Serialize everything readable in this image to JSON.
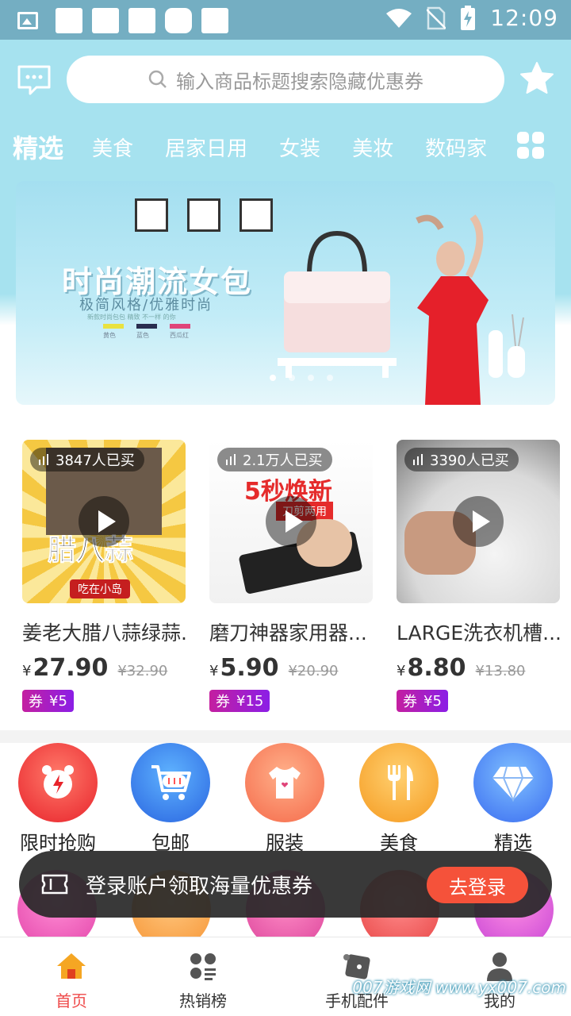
{
  "status_bar": {
    "time": "12:09"
  },
  "search": {
    "placeholder": "输入商品标题搜索隐藏优惠券"
  },
  "categories": [
    "精选",
    "美食",
    "居家日用",
    "女装",
    "美妆",
    "数码家"
  ],
  "banner": {
    "title": "时尚潮流女包",
    "subtitle": "极简风格/优雅时尚",
    "small_text": "新款时尚包包 精致 不一样 的你",
    "swatches": [
      {
        "label": "黄色",
        "color": "#e9e240"
      },
      {
        "label": "蓝色",
        "color": "#2a2e50"
      },
      {
        "label": "西瓜红",
        "color": "#e0457a"
      }
    ]
  },
  "products": [
    {
      "bought": "3847人已买",
      "title": "姜老大腊八蒜绿蒜...",
      "currency": "¥",
      "price": "27.90",
      "original": "¥32.90",
      "coupon_label": "券",
      "coupon_value": "¥5",
      "thumb_text": "腊八蒜",
      "thumb_sub": "吃在小岛"
    },
    {
      "bought": "2.1万人已买",
      "title": "磨刀神器家用器...",
      "currency": "¥",
      "price": "5.90",
      "original": "¥20.90",
      "coupon_label": "券",
      "coupon_value": "¥15",
      "thumb_text": "5秒焕新",
      "thumb_sub": "刀剪两用"
    },
    {
      "bought": "3390人已买",
      "title": "LARGE洗衣机槽...",
      "currency": "¥",
      "price": "8.80",
      "original": "¥13.80",
      "coupon_label": "券",
      "coupon_value": "¥5",
      "thumb_text": "",
      "thumb_sub": ""
    }
  ],
  "quick_icons": [
    {
      "label": "限时抢购",
      "icon": "alarm-clock-icon",
      "color": "#f03a3a"
    },
    {
      "label": "包邮",
      "icon": "shopping-cart-icon",
      "color": "#3a7cf0"
    },
    {
      "label": "服装",
      "icon": "clothing-icon",
      "color": "#f7795a"
    },
    {
      "label": "美食",
      "icon": "fork-knife-icon",
      "color": "#f7a530"
    },
    {
      "label": "精选",
      "icon": "diamond-icon",
      "color": "#4a8cf5"
    }
  ],
  "toast": {
    "text": "登录账户领取海量优惠券",
    "button": "去登录"
  },
  "tabs": [
    {
      "label": "首页",
      "icon": "home-icon",
      "active": true
    },
    {
      "label": "热销榜",
      "icon": "ranking-icon",
      "active": false
    },
    {
      "label": "手机配件",
      "icon": "phone-accessory-icon",
      "active": false
    },
    {
      "label": "我的",
      "icon": "profile-icon",
      "active": false
    }
  ],
  "watermark": "007游戏网 www.yx007.com",
  "colors": {
    "header_bg": "#a6e2ef",
    "accent_red": "#ef4a4a",
    "coupon_from": "#c41fa0",
    "coupon_to": "#8b1ee6",
    "login_btn": "#f5523a"
  }
}
